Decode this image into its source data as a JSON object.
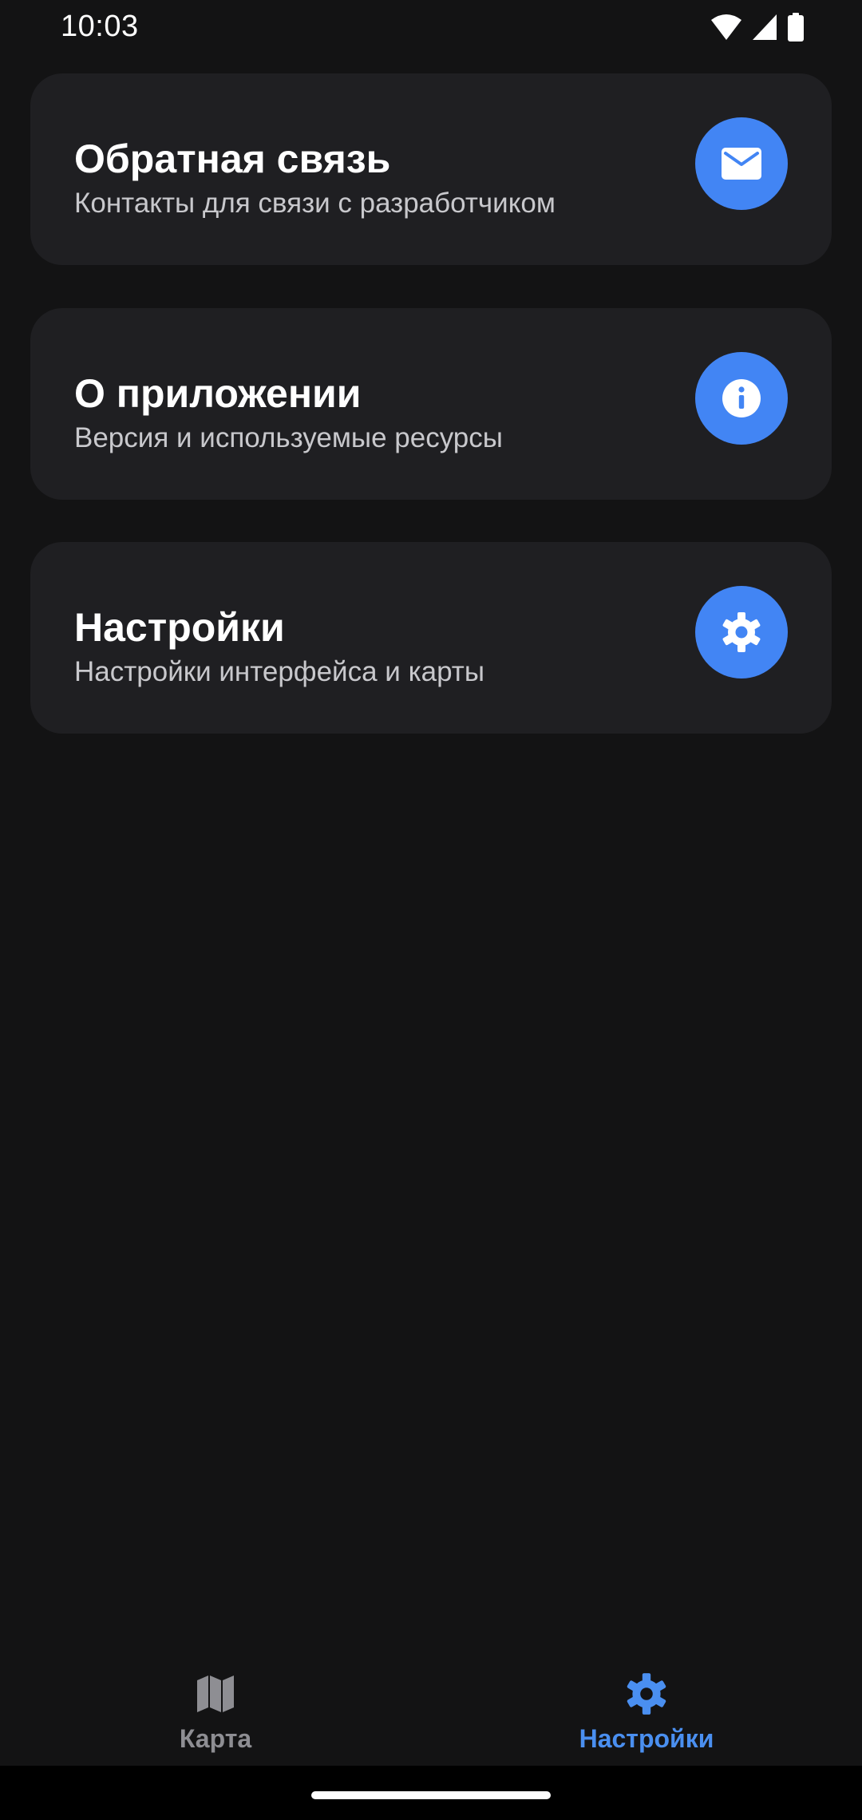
{
  "status_bar": {
    "time": "10:03",
    "icons": [
      "wifi-icon",
      "cell-signal-icon",
      "battery-icon"
    ]
  },
  "cards": [
    {
      "title": "Обратная связь",
      "subtitle": "Контакты для связи с разработчиком",
      "icon": "mail-icon"
    },
    {
      "title": "О приложении",
      "subtitle": "Версия и используемые ресурсы",
      "icon": "info-icon"
    },
    {
      "title": "Настройки",
      "subtitle": "Настройки интерфейса и карты",
      "icon": "gear-icon"
    }
  ],
  "bottom_nav": {
    "items": [
      {
        "label": "Карта",
        "icon": "map-icon",
        "active": false
      },
      {
        "label": "Настройки",
        "icon": "gear-icon",
        "active": true
      }
    ]
  },
  "colors": {
    "background": "#131314",
    "card": "#1f1f22",
    "accent": "#4285f4",
    "nav_active": "#4a8ff0",
    "nav_inactive": "#8e8e93"
  }
}
